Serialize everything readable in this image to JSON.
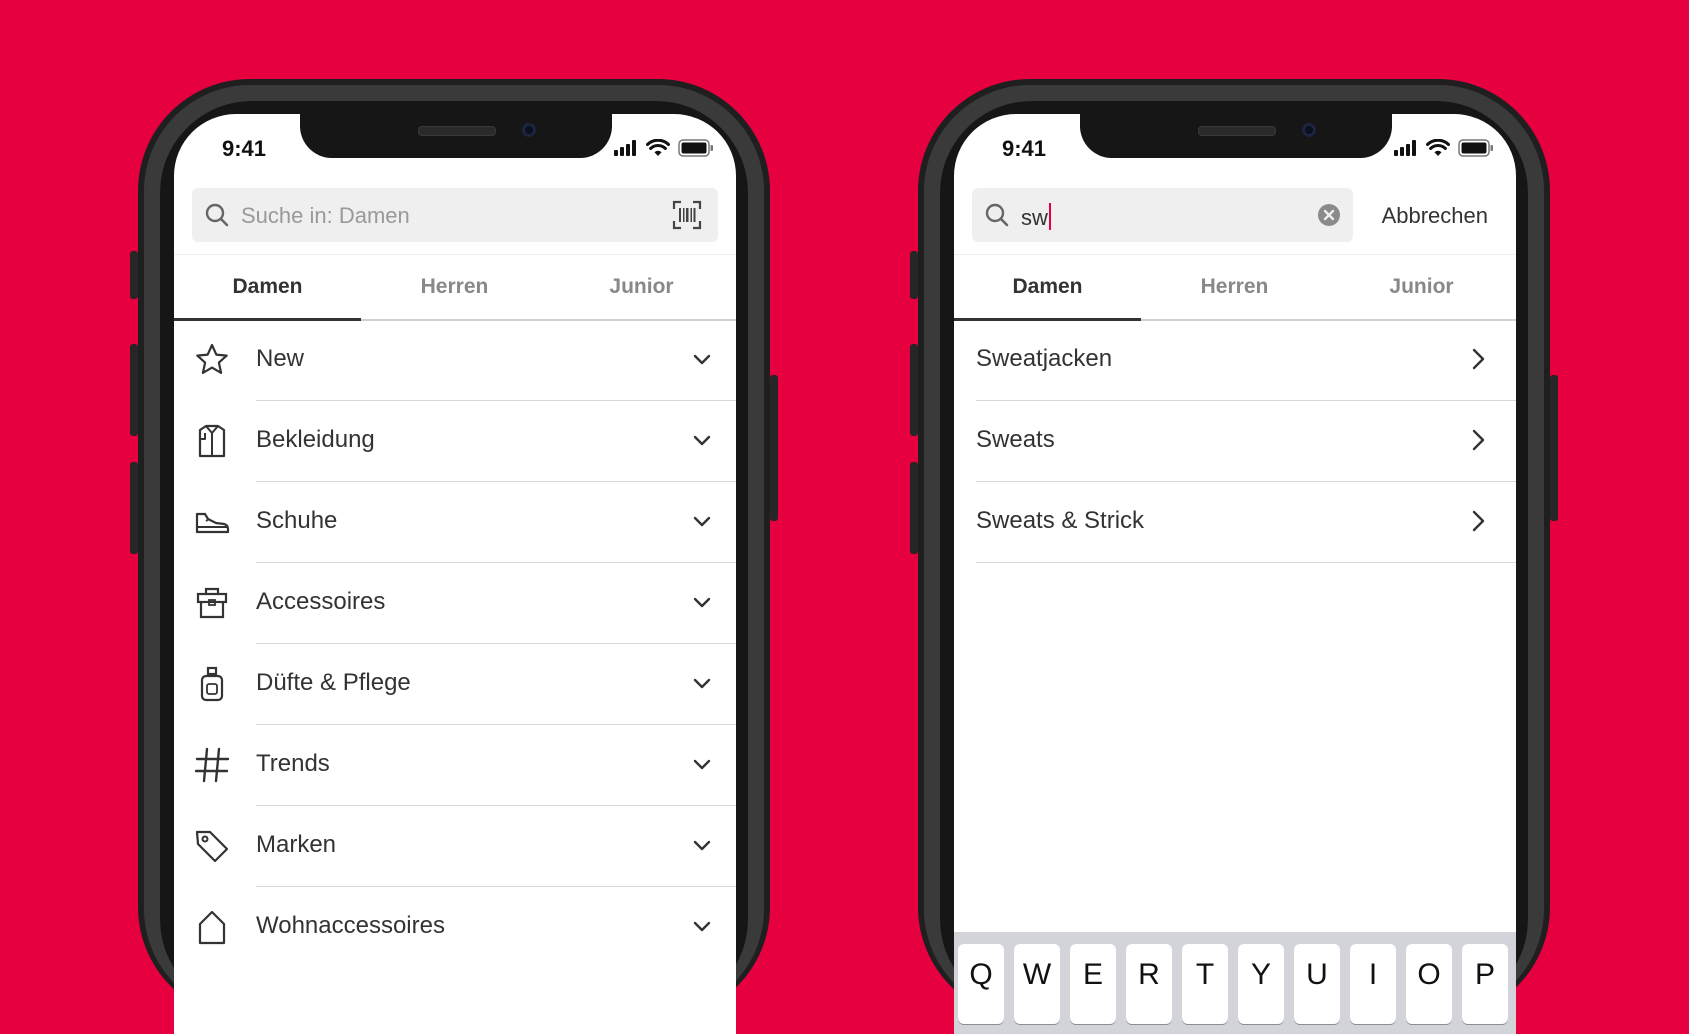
{
  "colors": {
    "background": "#E60040",
    "accent_caret": "#E60040",
    "text": "#333333",
    "muted": "#888888"
  },
  "left_phone": {
    "status": {
      "time": "9:41"
    },
    "search": {
      "placeholder": "Suche in: Damen",
      "icon": "search-icon",
      "scan_icon": "barcode-scan-icon"
    },
    "tabs": [
      {
        "label": "Damen",
        "active": true
      },
      {
        "label": "Herren",
        "active": false
      },
      {
        "label": "Junior",
        "active": false
      }
    ],
    "categories": [
      {
        "label": "New",
        "icon": "star-icon"
      },
      {
        "label": "Bekleidung",
        "icon": "shirt-icon"
      },
      {
        "label": "Schuhe",
        "icon": "sneaker-icon"
      },
      {
        "label": "Accessoires",
        "icon": "bag-icon"
      },
      {
        "label": "Düfte & Pflege",
        "icon": "perfume-bottle-icon"
      },
      {
        "label": "Trends",
        "icon": "hashtag-icon"
      },
      {
        "label": "Marken",
        "icon": "tag-icon"
      },
      {
        "label": "Wohnaccessoires",
        "icon": "house-icon"
      }
    ]
  },
  "right_phone": {
    "status": {
      "time": "9:41"
    },
    "search": {
      "value": "sw",
      "icon": "search-icon",
      "clear_icon": "clear-icon"
    },
    "cancel_label": "Abbrechen",
    "tabs": [
      {
        "label": "Damen",
        "active": true
      },
      {
        "label": "Herren",
        "active": false
      },
      {
        "label": "Junior",
        "active": false
      }
    ],
    "suggestions": [
      {
        "label": "Sweatjacken"
      },
      {
        "label": "Sweats"
      },
      {
        "label": "Sweats & Strick"
      }
    ],
    "keyboard_keys": [
      "Q",
      "W",
      "E",
      "R",
      "T",
      "Y",
      "U",
      "I",
      "O",
      "P"
    ]
  }
}
